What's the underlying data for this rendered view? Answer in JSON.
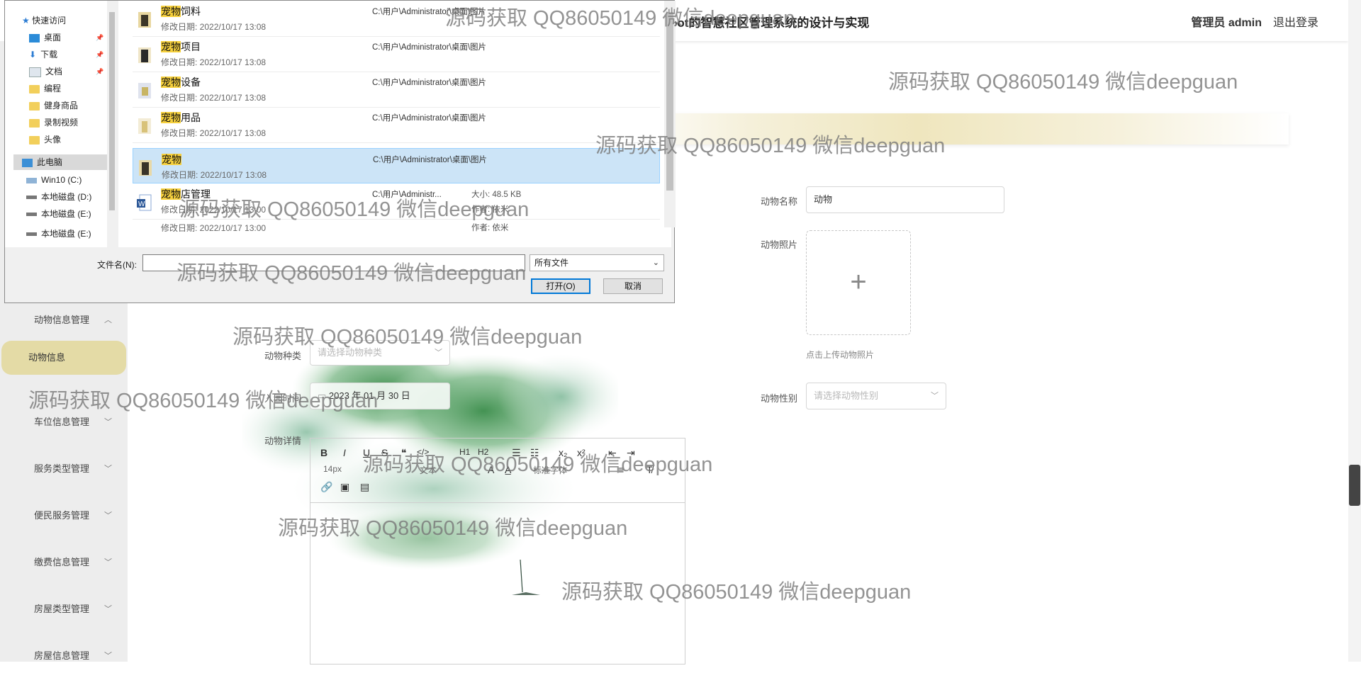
{
  "header": {
    "title": "oot的智慧社区管理系统的设计与实现",
    "user": "管理员 admin",
    "logout": "退出登录"
  },
  "sidebar": {
    "items": [
      {
        "label": "动物信息管理",
        "chevron": "^"
      },
      {
        "label": "动物信息",
        "active": true
      },
      {
        "label": "车位信息管理",
        "chevron": "⌄"
      },
      {
        "label": "服务类型管理",
        "chevron": "⌄"
      },
      {
        "label": "便民服务管理",
        "chevron": "⌄"
      },
      {
        "label": "缴费信息管理",
        "chevron": "⌄"
      },
      {
        "label": "房屋类型管理",
        "chevron": "⌄"
      },
      {
        "label": "房屋信息管理",
        "chevron": "⌄"
      }
    ]
  },
  "form": {
    "name_label": "动物名称",
    "name_value": "动物",
    "photo_label": "动物照片",
    "photo_tip": "点击上传动物照片",
    "species_label": "动物种类",
    "species_placeholder": "请选择动物种类",
    "gender_label": "动物性别",
    "gender_placeholder": "请选择动物性别",
    "date_label": "入园时间",
    "date_value": "2023 年 01 月 30 日",
    "detail_label": "动物详情"
  },
  "editor": {
    "toolbar": [
      "B",
      "I",
      "U",
      "S",
      "❝",
      "</>",
      "H1",
      "H2",
      "☰",
      "☷",
      "x₂",
      "x²",
      "⇤",
      "⇥"
    ],
    "font_size": "14px",
    "font_family": "标准字体",
    "normal_text": "文本"
  },
  "dialog": {
    "nav": {
      "quick_access": "快速访问",
      "items": [
        {
          "label": "桌面",
          "icon": "desktop-icon",
          "pinned": true
        },
        {
          "label": "下载",
          "icon": "download-icon",
          "pinned": true
        },
        {
          "label": "文档",
          "icon": "document-icon",
          "pinned": true
        },
        {
          "label": "编程",
          "icon": "folder-icon"
        },
        {
          "label": "健身商品",
          "icon": "folder-icon"
        },
        {
          "label": "录制视频",
          "icon": "folder-icon"
        },
        {
          "label": "头像",
          "icon": "folder-icon"
        }
      ],
      "this_pc": "此电脑",
      "drives": [
        "Win10 (C:)",
        "本地磁盘 (D:)",
        "本地磁盘 (E:)",
        "本地磁盘 (E:)"
      ]
    },
    "files": [
      {
        "hl": "宠物",
        "rest": "饲料",
        "date": "修改日期: 2022/10/17 13:08",
        "path": "C:\\用户\\Administrator\\桌面\\图片",
        "selected": false
      },
      {
        "hl": "宠物",
        "rest": "项目",
        "date": "修改日期: 2022/10/17 13:08",
        "path": "C:\\用户\\Administrator\\桌面\\图片",
        "selected": false
      },
      {
        "hl": "宠物",
        "rest": "设备",
        "date": "修改日期: 2022/10/17 13:08",
        "path": "C:\\用户\\Administrator\\桌面\\图片",
        "selected": false
      },
      {
        "hl": "宠物",
        "rest": "用品",
        "date": "修改日期: 2022/10/17 13:08",
        "path": "C:\\用户\\Administrator\\桌面\\图片",
        "selected": false
      },
      {
        "hl": "宠物",
        "rest": "",
        "date": "修改日期: 2022/10/17 13:08",
        "path": "C:\\用户\\Administrator\\桌面\\图片",
        "selected": true
      },
      {
        "hl": "宠物",
        "rest": "店管理",
        "date": "修改日期: 2022/10/17 13:00",
        "path": "C:\\用户\\Administr...",
        "size": "大小: 48.5 KB",
        "author": "作者: 依米",
        "selected": false
      },
      {
        "hl": "",
        "rest": "",
        "date": "修改日期: 2022/10/17 13:00",
        "path": "",
        "author": "作者: 依米",
        "selected": false
      }
    ],
    "filename_label": "文件名(N):",
    "filename_value": "",
    "filetype": "所有文件",
    "open_btn": "打开(O)",
    "cancel_btn": "取消"
  },
  "watermark": "源码获取 QQ86050149 微信deepguan"
}
